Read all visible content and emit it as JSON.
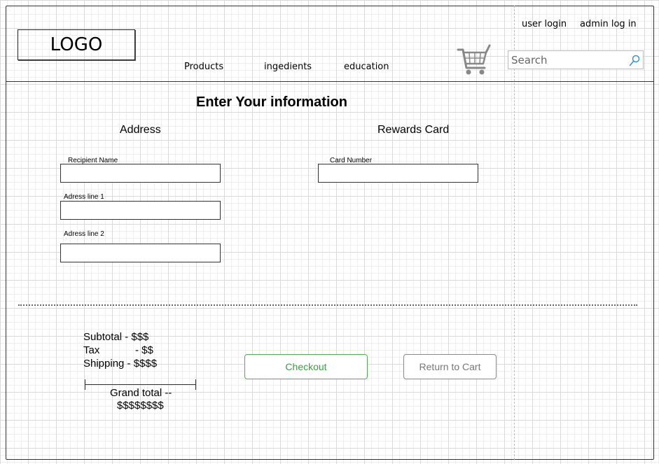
{
  "header": {
    "logo": "LOGO",
    "nav": [
      "Products",
      "ingedients",
      "education"
    ],
    "user_login": "user login",
    "admin_login": "admin log in",
    "search_placeholder": "Search"
  },
  "form": {
    "title": "Enter Your information",
    "address": {
      "heading": "Address",
      "recipient_label": "Recipient Name",
      "line1_label": "Adress line 1",
      "line2_label": "Adress line 2"
    },
    "rewards": {
      "heading": "Rewards Card",
      "card_label": "Card Number"
    }
  },
  "summary": {
    "subtotal": "Subtotal - $$$",
    "tax_label": "Tax",
    "tax_value": "- $$",
    "shipping": "Shipping - $$$$",
    "grand_total_label": "Grand total --",
    "grand_total_value": "$$$$$$$$"
  },
  "buttons": {
    "checkout": "Checkout",
    "return_to_cart": "Return to Cart"
  },
  "colors": {
    "checkout_border": "#4caf50",
    "return_border": "#888888"
  }
}
